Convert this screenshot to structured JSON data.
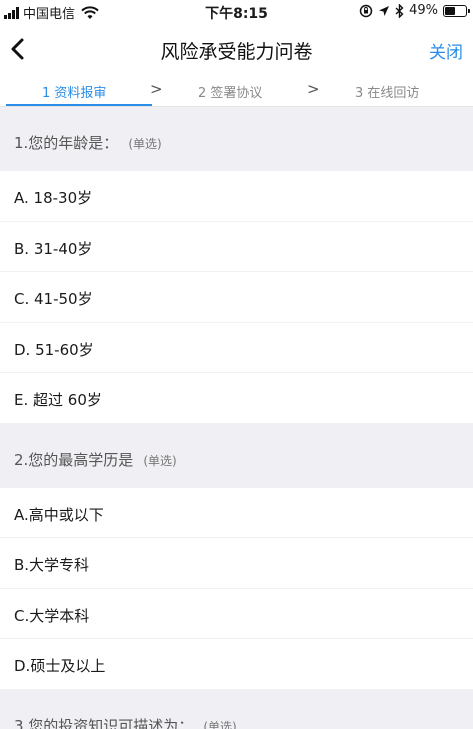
{
  "status_bar": {
    "carrier": "中国电信",
    "time": "下午8:15",
    "battery_text": "49%",
    "battery_level": 0.49
  },
  "nav": {
    "title": "风险承受能力问卷",
    "close_label": "关闭"
  },
  "steps": [
    {
      "label": "1 资料报审",
      "active": true
    },
    {
      "label": "2 签署协议",
      "active": false
    },
    {
      "label": "3 在线回访",
      "active": false
    }
  ],
  "step_separator": ">",
  "questions": [
    {
      "text": "1.您的年龄是：",
      "tag": "(单选)",
      "options": [
        "A. 18-30岁",
        "B.  31-40岁",
        "C.  41-50岁",
        "D.  51-60岁",
        "E.  超过 60岁"
      ]
    },
    {
      "text": "2.您的最高学历是",
      "tag": "(单选)",
      "options": [
        "A.高中或以下",
        "B.大学专科",
        "C.大学本科",
        "D.硕士及以上"
      ]
    },
    {
      "text": "3.您的投资知识可描述为：",
      "tag": "(单选)",
      "options": []
    }
  ],
  "colors": {
    "accent": "#2a8ee8",
    "section_bg": "#efeff4"
  },
  "icons": {
    "back": "chevron-left-icon",
    "wifi": "wifi-icon",
    "lock_rotation": "orientation-lock-icon",
    "location": "location-arrow-icon",
    "bluetooth": "bluetooth-icon",
    "battery": "battery-icon",
    "signal": "signal-icon"
  }
}
